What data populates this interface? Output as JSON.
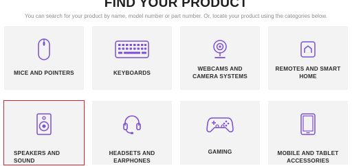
{
  "header": {
    "title": "FIND YOUR PRODUCT",
    "subtitle": "You can search for your product by name, model number or part number. Or, locate your product using the categories below."
  },
  "categories": [
    {
      "label": "MICE AND POINTERS",
      "icon": "mouse-icon"
    },
    {
      "label": "KEYBOARDS",
      "icon": "keyboard-icon"
    },
    {
      "label": "WEBCAMS AND CAMERA SYSTEMS",
      "icon": "webcam-icon"
    },
    {
      "label": "REMOTES AND SMART HOME",
      "icon": "smart-home-icon"
    },
    {
      "label": "SPEAKERS AND SOUND",
      "icon": "speaker-icon",
      "selected": true
    },
    {
      "label": "HEADSETS AND EARPHONES",
      "icon": "headset-icon"
    },
    {
      "label": "GAMING",
      "icon": "gamepad-icon"
    },
    {
      "label": "MOBILE AND TABLET ACCESSORIES",
      "icon": "tablet-icon"
    }
  ],
  "colors": {
    "icon_accent": "#7b4fd6",
    "tile_bg": "#f3f3f3",
    "selected_outline": "#e0242d"
  }
}
